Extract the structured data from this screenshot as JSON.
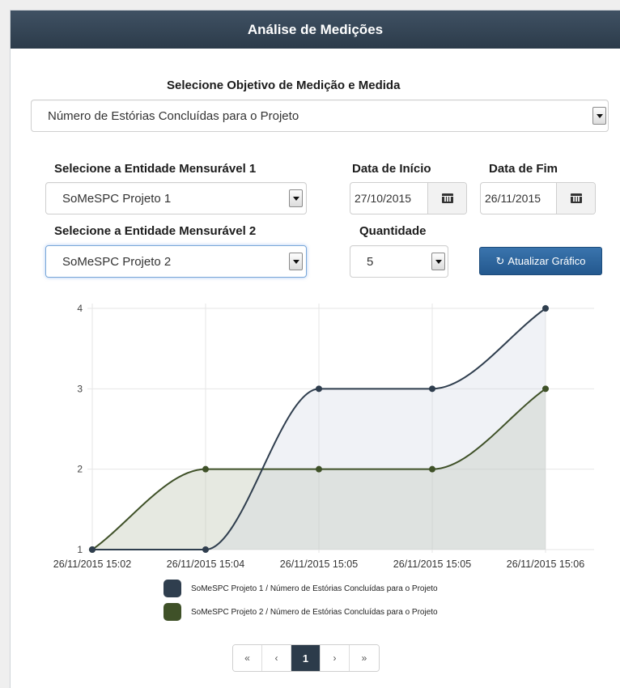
{
  "header": {
    "title": "Análise de Medições"
  },
  "objective": {
    "label": "Selecione Objetivo de Medição e Medida",
    "value": "Número de Estórias Concluídas para o Projeto"
  },
  "entity1": {
    "label": "Selecione a Entidade Mensurável 1",
    "value": "SoMeSPC Projeto 1"
  },
  "entity2": {
    "label": "Selecione a Entidade Mensurável 2",
    "value": "SoMeSPC Projeto 2"
  },
  "start_date": {
    "label": "Data de Início",
    "value": "27/10/2015"
  },
  "end_date": {
    "label": "Data de Fim",
    "value": "26/11/2015"
  },
  "quantity": {
    "label": "Quantidade",
    "value": "5"
  },
  "refresh_button": {
    "label": "Atualizar Gráfico",
    "icon": "refresh-icon"
  },
  "pagination": {
    "first": "«",
    "prev": "‹",
    "current": "1",
    "next": "›",
    "last": "»"
  },
  "chart_data": {
    "type": "line",
    "categories": [
      "26/11/2015 15:02",
      "26/11/2015 15:04",
      "26/11/2015 15:05",
      "26/11/2015 15:05",
      "26/11/2015 15:06"
    ],
    "series": [
      {
        "name": "SoMeSPC Projeto 1 / Número de Estórias Concluídas para o Projeto",
        "values": [
          1,
          1,
          3,
          3,
          4
        ],
        "color": "#2f3e4e",
        "fill": "rgba(200,208,222,0.28)"
      },
      {
        "name": "SoMeSPC Projeto 2 / Número de Estórias Concluídas para o Projeto",
        "values": [
          1,
          2,
          2,
          2,
          3
        ],
        "color": "#3f5128",
        "fill": "rgba(188,196,176,0.38)"
      }
    ],
    "y_ticks": [
      "1",
      "2",
      "3",
      "4"
    ],
    "ylim": [
      1,
      4
    ],
    "grid": true,
    "legend_position": "bottom",
    "area_fill": true
  }
}
